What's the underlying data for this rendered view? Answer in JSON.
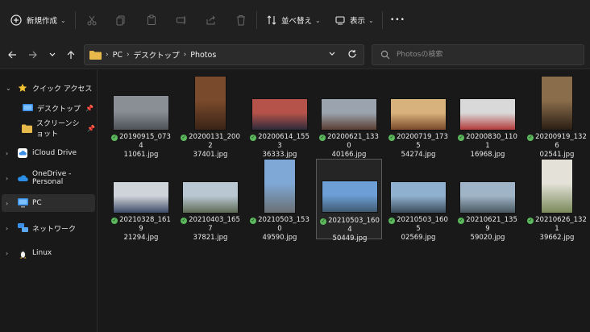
{
  "toolbar": {
    "new_label": "新規作成",
    "sort_label": "並べ替え",
    "view_label": "表示",
    "more_label": "•••"
  },
  "address": {
    "crumbs": [
      "PC",
      "デスクトップ",
      "Photos"
    ]
  },
  "search": {
    "placeholder": "Photosの検索"
  },
  "sidebar": {
    "items": [
      {
        "label": "クイック アクセス"
      },
      {
        "label": "デスクトップ"
      },
      {
        "label": "スクリーンショット"
      },
      {
        "label": "iCloud Drive"
      },
      {
        "label": "OneDrive - Personal"
      },
      {
        "label": "PC"
      },
      {
        "label": "ネットワーク"
      },
      {
        "label": "Linux"
      }
    ]
  },
  "files": [
    {
      "line1": "20190915_0734",
      "line2": "11061.jpg",
      "colors": [
        "#8a8f96",
        "#4e5257"
      ]
    },
    {
      "line1": "20200131_2002",
      "line2": "37401.jpg",
      "colors": [
        "#7a4a2c",
        "#3a2416"
      ]
    },
    {
      "line1": "20200614_1553",
      "line2": "36333.jpg",
      "colors": [
        "#b5534a",
        "#2d2a3a"
      ]
    },
    {
      "line1": "20200621_1330",
      "line2": "40166.jpg",
      "colors": [
        "#9aa3ae",
        "#5a3d32"
      ]
    },
    {
      "line1": "20200719_1735",
      "line2": "54274.jpg",
      "colors": [
        "#d8b27c",
        "#7a4a2a"
      ]
    },
    {
      "line1": "20200830_1101",
      "line2": "16968.jpg",
      "colors": [
        "#d9d9d9",
        "#b33a3a"
      ]
    },
    {
      "line1": "20200919_1326",
      "line2": "02541.jpg",
      "colors": [
        "#8a6d4b",
        "#2a1e14"
      ]
    },
    {
      "line1": "20210328_1619",
      "line2": "21294.jpg",
      "colors": [
        "#cfd4da",
        "#3d4a66"
      ]
    },
    {
      "line1": "20210403_1657",
      "line2": "37821.jpg",
      "colors": [
        "#b9c7d3",
        "#5e6a55"
      ]
    },
    {
      "line1": "20210503_1530",
      "line2": "49590.jpg",
      "colors": [
        "#7fa8d6",
        "#6a6f73"
      ]
    },
    {
      "line1": "20210503_1604",
      "line2": "50449.jpg",
      "colors": [
        "#6d9ed6",
        "#3f5a72"
      ]
    },
    {
      "line1": "20210503_1605",
      "line2": "02569.jpg",
      "colors": [
        "#8fb0cf",
        "#3a4b5a"
      ]
    },
    {
      "line1": "20210621_1359",
      "line2": "59020.jpg",
      "colors": [
        "#9fb4c6",
        "#4a5862"
      ]
    },
    {
      "line1": "20210626_1321",
      "line2": "39662.jpg",
      "colors": [
        "#e3e1d8",
        "#7a8a5a"
      ]
    }
  ],
  "colors": {
    "folder": "#e7b94a",
    "accent": "#4aa3ff",
    "check": "#5cb85c"
  }
}
